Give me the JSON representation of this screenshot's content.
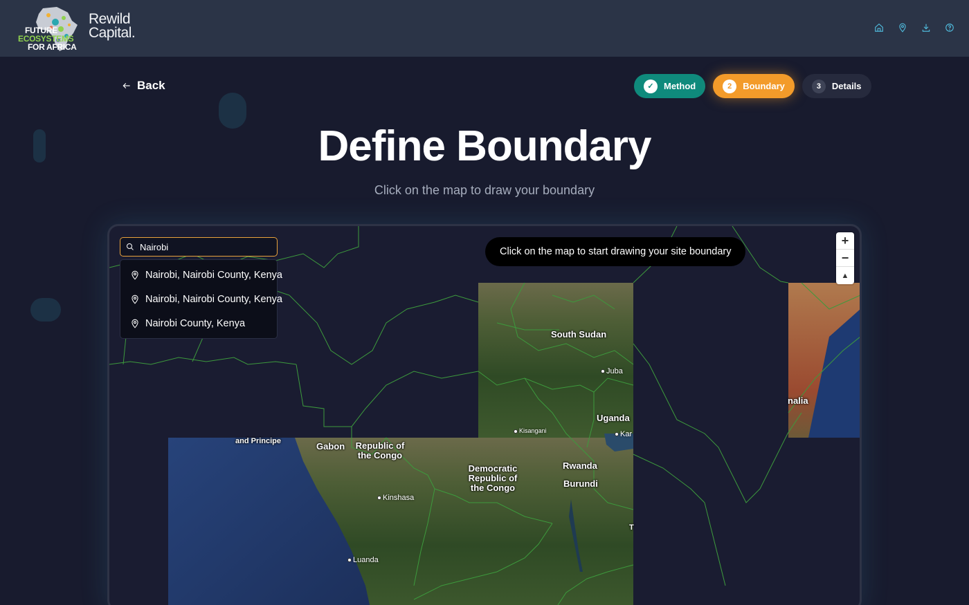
{
  "header": {
    "logo_line1": "FUTURE",
    "logo_line2": "ECOSYSTEMS",
    "logo_line3": "FOR AFRICA",
    "brand_line1": "Rewild",
    "brand_line2": "Capital.",
    "icons": [
      "home-icon",
      "map-pin-icon",
      "download-icon",
      "help-icon"
    ],
    "accent_color": "#4fb7d8"
  },
  "back_label": "Back",
  "steps": [
    {
      "num": "✓",
      "label": "Method",
      "state": "done"
    },
    {
      "num": "2",
      "label": "Boundary",
      "state": "active"
    },
    {
      "num": "3",
      "label": "Details",
      "state": "todo"
    }
  ],
  "title": "Define Boundary",
  "subtitle": "Click on the map to draw your boundary",
  "search": {
    "value": "Nairobi",
    "results": [
      "Nairobi, Nairobi County, Kenya",
      "Nairobi, Nairobi County, Kenya",
      "Nairobi County, Kenya"
    ]
  },
  "map": {
    "hint": "Click on the map to start drawing your site boundary",
    "zoom_in": "+",
    "zoom_out": "−",
    "reset": "▲",
    "labels": {
      "south_sudan": "South Sudan",
      "uganda": "Uganda",
      "gabon": "Gabon",
      "roc": "Republic of the Congo",
      "drc": "Democratic Republic of the Congo",
      "rwanda": "Rwanda",
      "burundi": "Burundi",
      "somalia_partial": "nalia",
      "sao_tome_partial": "and Principe"
    },
    "cities": {
      "juba": "Juba",
      "kisangani": "Kisangani",
      "kampala_partial": "Kar",
      "kinshasa": "Kinshasa",
      "luanda": "Luanda",
      "t_partial": "T"
    }
  }
}
